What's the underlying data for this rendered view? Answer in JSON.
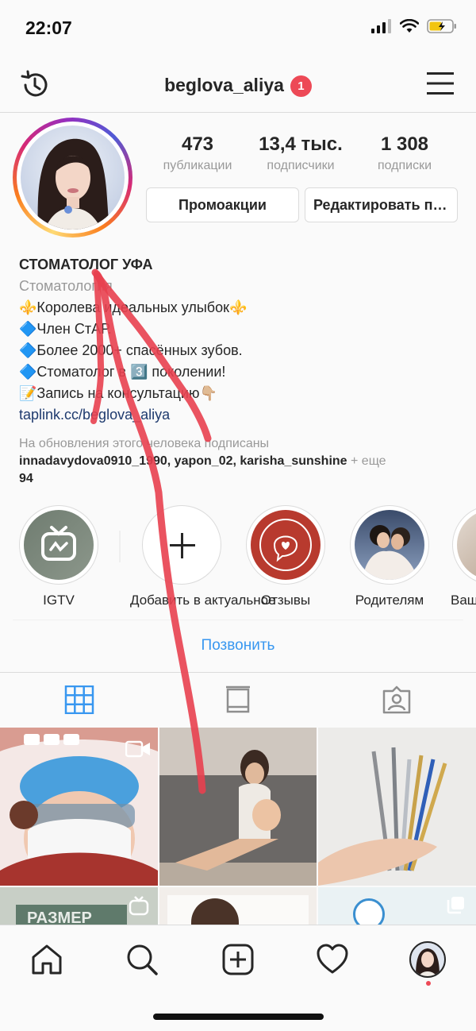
{
  "status": {
    "time": "22:07"
  },
  "header": {
    "username": "beglova_aliya",
    "badge_count": "1"
  },
  "profile": {
    "stats": [
      {
        "value": "473",
        "label": "публикации"
      },
      {
        "value": "13,4 тыс.",
        "label": "подписчики"
      },
      {
        "value": "1 308",
        "label": "подписки"
      }
    ],
    "buttons": {
      "promo": "Промоакции",
      "edit": "Редактировать профиль"
    }
  },
  "bio": {
    "name": "СТОМАТОЛОГ УФА",
    "category": "Стоматология",
    "lines": [
      "⚜️Королева идеальных улыбок⚜️",
      "🔷Член СтАР.",
      "🔷Более 2000+ спасённых зубов.",
      "🔷Стоматолог в 3️⃣ поколении!",
      "📝Запись на консультацию👇🏼"
    ],
    "link": "taplink.cc/beglova_aliya"
  },
  "followed_by": {
    "intro": "На обновления этого человека подписаны",
    "users": "innadavydova0910_1990, yapon_02, karisha_sunshine",
    "more": " + еще",
    "count": "94"
  },
  "highlights": [
    {
      "label": "IGTV",
      "icon": "igtv-icon"
    },
    {
      "label": "Добавить в актуальное",
      "icon": "plus-icon"
    },
    {
      "label": "Отзывы",
      "icon": "heart-bubble-icon"
    },
    {
      "label": "Родителям",
      "icon": "photo"
    },
    {
      "label": "Ваши",
      "icon": "photo"
    }
  ],
  "contact": {
    "call": "Позвонить"
  },
  "tabs": [
    {
      "name": "grid",
      "icon": "grid-icon",
      "active": true
    },
    {
      "name": "igtv",
      "icon": "igtv-tab-icon",
      "active": false
    },
    {
      "name": "tagged",
      "icon": "tagged-icon",
      "active": false
    }
  ],
  "colors": {
    "accent": "#3897f0",
    "badge": "#ed4956",
    "arrow": "#e8404f",
    "text": "#262626",
    "muted": "#999999"
  }
}
